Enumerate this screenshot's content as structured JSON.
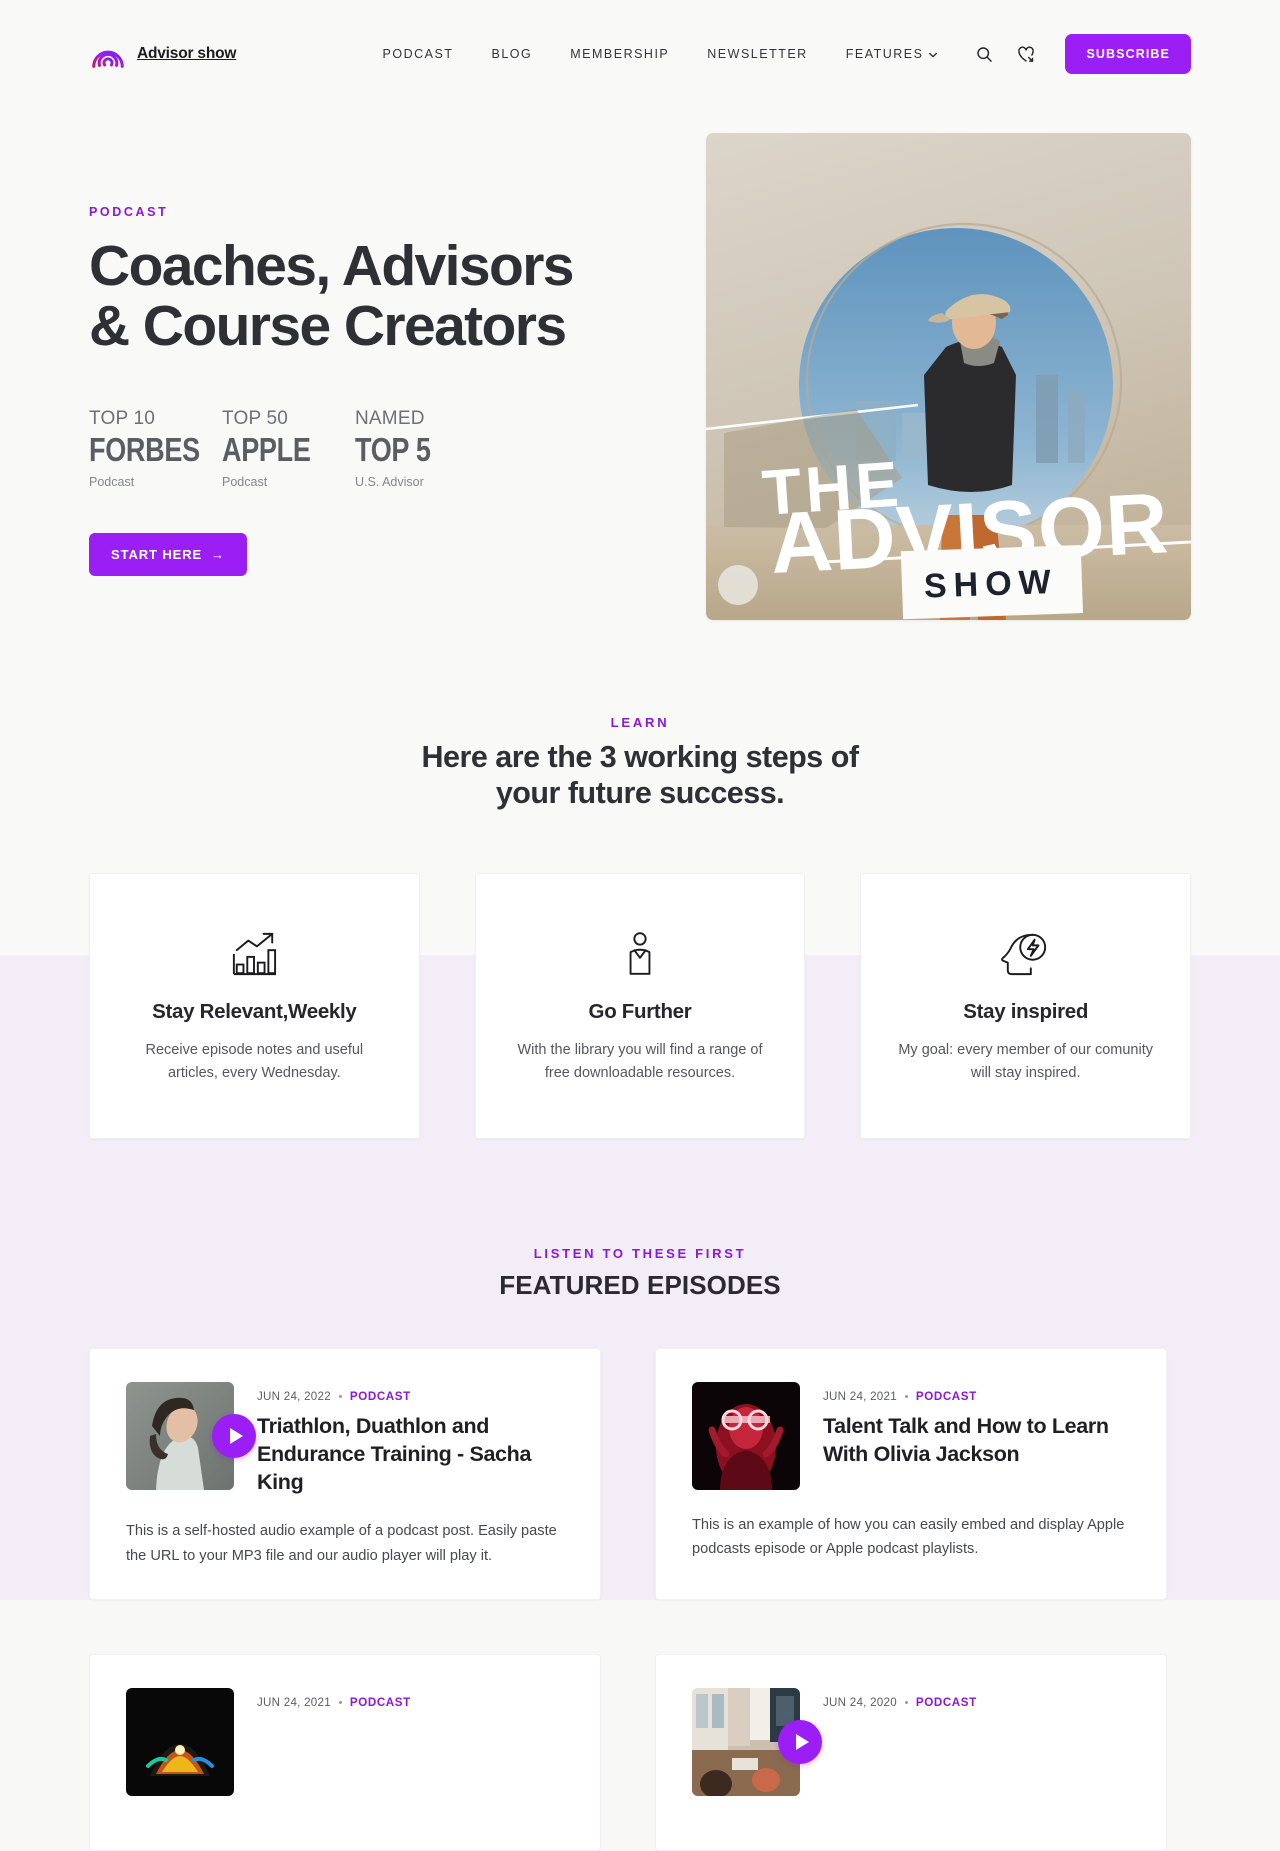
{
  "brand": {
    "name": "Advisor show",
    "logo_icon": "podcast-waves-icon"
  },
  "nav": {
    "items": [
      {
        "label": "PODCAST"
      },
      {
        "label": "BLOG"
      },
      {
        "label": "MEMBERSHIP"
      },
      {
        "label": "NEWSLETTER"
      },
      {
        "label": "FEATURES",
        "has_caret": true
      }
    ],
    "search_icon": "search-icon",
    "wishlist_icon": "heart-share-icon",
    "subscribe_label": "SUBSCRIBE"
  },
  "hero": {
    "eyebrow": "PODCAST",
    "title_line1": "Coaches, Advisors",
    "title_line2": "& Course Creators",
    "stats": [
      {
        "top": "TOP 10",
        "mid": "FORBES",
        "sub": "Podcast"
      },
      {
        "top": "TOP 50",
        "mid": "APPLE",
        "sub": "Podcast"
      },
      {
        "top": "NAMED",
        "mid": "TOP 5",
        "sub": "U.S. Advisor"
      }
    ],
    "cta_label": "START HERE",
    "cta_arrow": "→",
    "cover": {
      "line1": "THE",
      "line2": "ADVISOR",
      "line3": "SHOW",
      "alt": "podcast cover art"
    }
  },
  "learn": {
    "eyebrow": "LEARN",
    "title_line1": "Here are the 3 working steps of",
    "title_line2": "your future success.",
    "cards": [
      {
        "icon": "growth-chart-icon",
        "title": "Stay Relevant,Weekly",
        "text": "Receive episode notes and useful articles, every Wednesday."
      },
      {
        "icon": "person-icon",
        "title": "Go Further",
        "text": "With the library you will find a range of free downloadable resources."
      },
      {
        "icon": "head-lightning-icon",
        "title": "Stay inspired",
        "text": "My goal: every member of our comunity will stay inspired."
      }
    ]
  },
  "featured": {
    "eyebrow": "LISTEN TO THESE FIRST",
    "title": "FEATURED EPISODES",
    "episodes": [
      {
        "date": "JUN 24, 2022",
        "category": "PODCAST",
        "title": "Triathlon, Duathlon and Endurance Training - Sacha King",
        "description": "This is a self-hosted audio example of a podcast post. Easily paste the URL to your MP3 file and our audio player will play it.",
        "has_play": true,
        "thumb": "portrait-looking-up"
      },
      {
        "date": "JUN 24, 2021",
        "category": "PODCAST",
        "title": "Talent Talk and How to Learn With Olivia Jackson",
        "description": "This is an example of how you can easily embed and display Apple podcasts episode or Apple podcast playlists.",
        "has_play": false,
        "thumb": "red-neon-portrait"
      },
      {
        "date": "JUN 24, 2021",
        "category": "PODCAST",
        "title": "",
        "description": "",
        "has_play": false,
        "thumb": "dark-neon-scene"
      },
      {
        "date": "JUN 24, 2020",
        "category": "PODCAST",
        "title": "",
        "description": "",
        "has_play": true,
        "thumb": "cafe-interior"
      }
    ]
  },
  "colors": {
    "accent": "#9b1ff5",
    "eyebrow": "#8b17d8",
    "text_dark": "#2f3035",
    "bg_top": "#f9f9f8",
    "bg_bottom": "#f2edf7"
  }
}
